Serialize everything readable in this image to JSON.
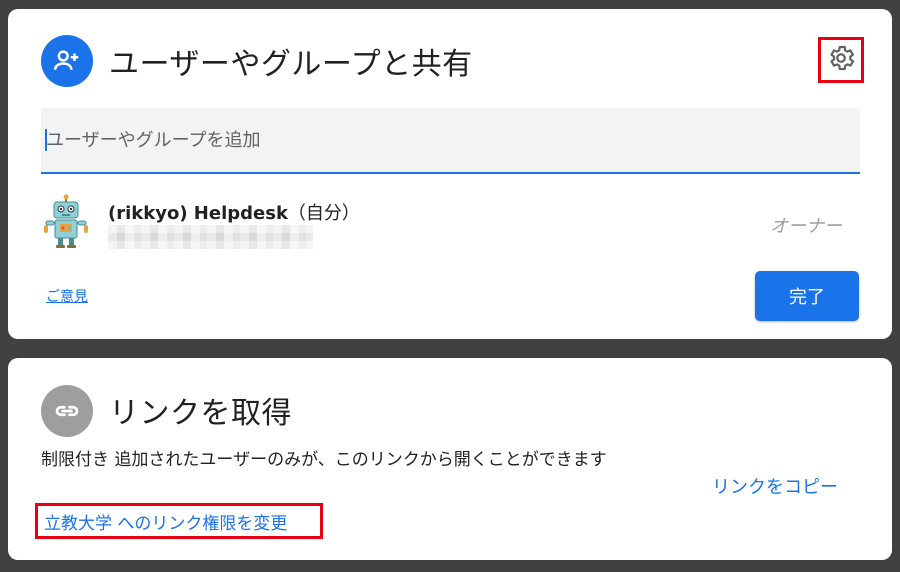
{
  "share": {
    "title": "ユーザーやグループと共有",
    "input_placeholder": "ユーザーやグループを追加",
    "user": {
      "name": "(rikkyo) Helpdesk",
      "self_label": "（自分）",
      "role": "オーナー"
    },
    "feedback_label": "ご意見",
    "done_label": "完了"
  },
  "link": {
    "title": "リンクを取得",
    "restriction": "制限付き",
    "description": "追加されたユーザーのみが、このリンクから開くことができます",
    "change_label": "立教大学 へのリンク権限を変更",
    "copy_label": "リンクをコピー"
  },
  "icons": {
    "share": "person-add-icon",
    "settings": "gear-icon",
    "link": "link-icon",
    "avatar": "robot-avatar"
  },
  "colors": {
    "accent": "#1a73e8",
    "highlight_box": "#e60012",
    "link_icon_bg": "#9e9e9e"
  }
}
